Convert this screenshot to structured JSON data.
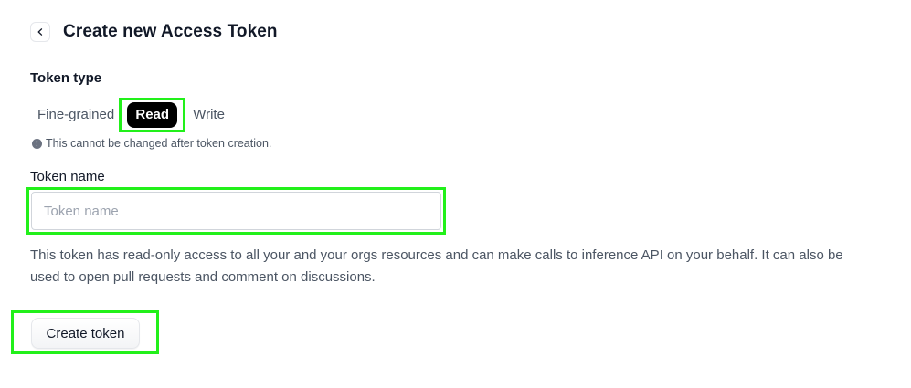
{
  "header": {
    "title": "Create new Access Token",
    "back_icon": "chevron-left-icon"
  },
  "token_type": {
    "label": "Token type",
    "options": [
      "Fine-grained",
      "Read",
      "Write"
    ],
    "selected": "Read",
    "note": "This cannot be changed after token creation.",
    "note_icon": "info-icon"
  },
  "token_name": {
    "label": "Token name",
    "placeholder": "Token name",
    "value": ""
  },
  "description": "This token has read-only access to all your and your orgs resources and can make calls to inference API on your behalf. It can also be used to open pull requests and comment on discussions.",
  "actions": {
    "create_label": "Create token"
  },
  "colors": {
    "highlight": "#22f01a",
    "active_tab_bg": "#000000"
  }
}
